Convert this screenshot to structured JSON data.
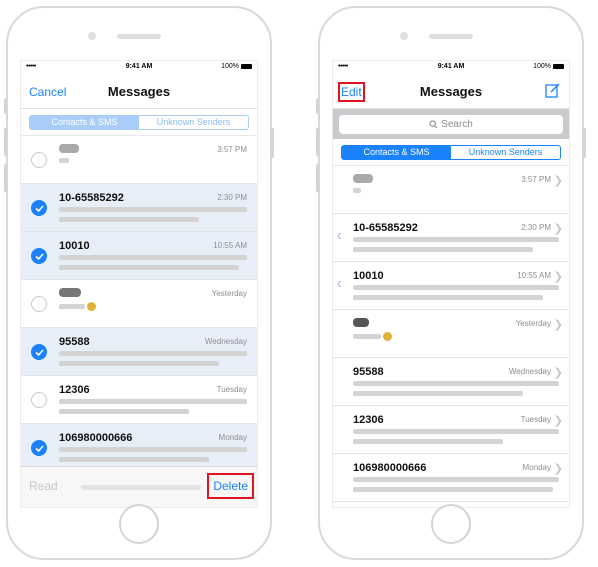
{
  "left": {
    "status": {
      "time": "9:41 AM",
      "battery": "100%",
      "signal": "•••••"
    },
    "nav": {
      "left": "Cancel",
      "title": "Messages"
    },
    "tabs": [
      {
        "label": "Contacts & SMS",
        "active": true
      },
      {
        "label": "Unknown Senders",
        "active": false
      }
    ],
    "rows": [
      {
        "sender": "",
        "time": "3:57 PM",
        "selected": false
      },
      {
        "sender": "10-65585292",
        "time": "2:30 PM",
        "selected": true
      },
      {
        "sender": "10010",
        "time": "10:55 AM",
        "selected": true
      },
      {
        "sender": "",
        "time": "Yesterday",
        "selected": false
      },
      {
        "sender": "95588",
        "time": "Wednesday",
        "selected": true
      },
      {
        "sender": "12306",
        "time": "Tuesday",
        "selected": false
      },
      {
        "sender": "106980000666",
        "time": "Monday",
        "selected": true
      }
    ],
    "footer": {
      "read": "Read",
      "delete": "Delete"
    }
  },
  "right": {
    "status": {
      "time": "9:41 AM",
      "battery": "100%",
      "signal": "•••••"
    },
    "nav": {
      "left": "Edit",
      "title": "Messages"
    },
    "search": {
      "placeholder": "Search"
    },
    "tabs": [
      {
        "label": "Contacts & SMS",
        "active": true
      },
      {
        "label": "Unknown Senders",
        "active": false
      }
    ],
    "rows": [
      {
        "sender": "",
        "time": "3:57 PM",
        "muted": false
      },
      {
        "sender": "10-65585292",
        "time": "2:30 PM",
        "muted": true
      },
      {
        "sender": "10010",
        "time": "10:55 AM",
        "muted": true
      },
      {
        "sender": "",
        "time": "Yesterday",
        "muted": false
      },
      {
        "sender": "95588",
        "time": "Wednesday",
        "muted": false
      },
      {
        "sender": "12306",
        "time": "Tuesday",
        "muted": false
      },
      {
        "sender": "106980000666",
        "time": "Monday",
        "muted": false
      }
    ]
  },
  "colors": {
    "accent": "#1a82fb",
    "highlight": "#e0141e"
  },
  "icons": {
    "compose": "compose-icon",
    "search": "search-icon",
    "check": "checkmark-icon",
    "mute": "moon-icon",
    "chevron": "chevron-right-icon"
  }
}
